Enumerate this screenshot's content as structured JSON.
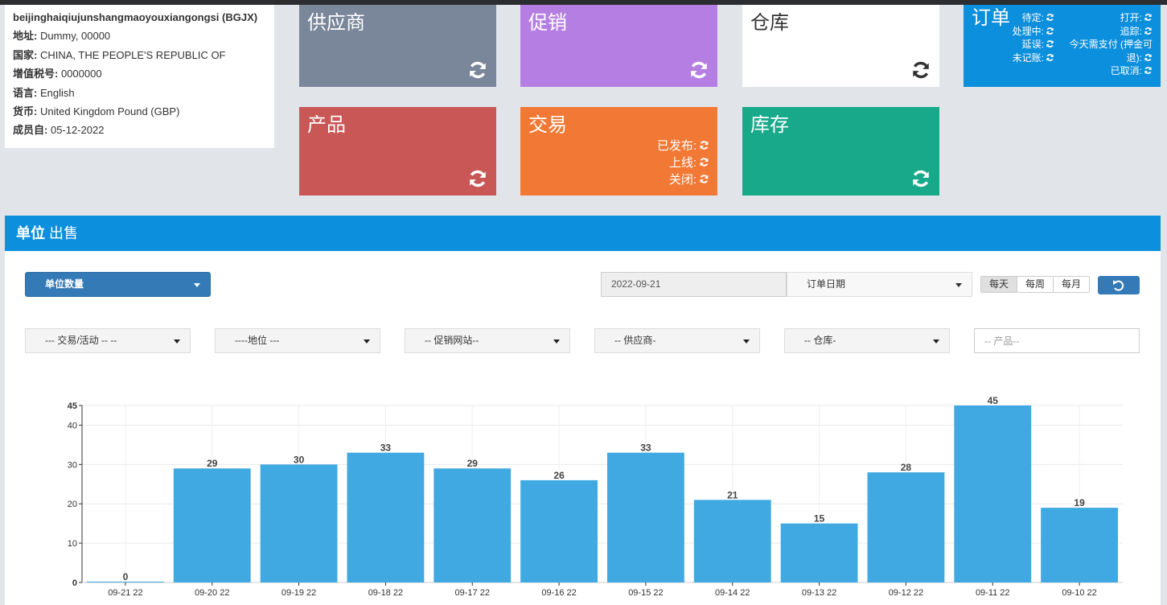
{
  "company": {
    "name": "beijinghaiqiujunshangmaoyouxiangongsi (BGJX)",
    "rows": [
      {
        "label": "地址:",
        "value": "Dummy, 00000"
      },
      {
        "label": "国家:",
        "value": "CHINA, THE PEOPLE'S REPUBLIC OF"
      },
      {
        "label": "增值税号:",
        "value": "0000000"
      },
      {
        "label": "语言:",
        "value": "English"
      },
      {
        "label": "货币:",
        "value": "United Kingdom Pound (GBP)"
      },
      {
        "label": "成员自:",
        "value": "05-12-2022"
      }
    ]
  },
  "tiles": {
    "supplier": "供应商",
    "promo": "促销",
    "warehouse": "仓库",
    "product": "产品",
    "trade": {
      "title": "交易",
      "stats": [
        "已发布:",
        "上线:",
        "关闭:"
      ]
    },
    "stock": "库存",
    "orders": {
      "title": "订单",
      "left": [
        "待定:",
        "处理中:",
        "延误:",
        "未记账:"
      ],
      "right": [
        "打开:",
        "追踪:",
        "今天需支付 (押金可",
        "退):",
        "已取消:"
      ]
    }
  },
  "colors": {
    "supplier": "#7a8699",
    "promo": "#b57ee2",
    "warehouse": "#ffffff",
    "product": "#c85756",
    "trade": "#f27935",
    "stock": "#18a98a",
    "orders": "#0c8fdc",
    "bar": "#41a9e1"
  },
  "panel": {
    "title_bold": "单位",
    "title_rest": "出售",
    "metric_select": "单位数量",
    "date_value": "2022-09-21",
    "date_type": "订单日期",
    "periods": [
      "每天",
      "每周",
      "每月"
    ],
    "filters": [
      "--- 交易/活动 -- --",
      "----地位 ---",
      "-- 促销网站--",
      "-- 供应商-",
      "-- 仓库-"
    ],
    "product_placeholder": "-- 产品--"
  },
  "chart_data": {
    "type": "bar",
    "categories": [
      "09-21 22",
      "09-20 22",
      "09-19 22",
      "09-18 22",
      "09-17 22",
      "09-16 22",
      "09-15 22",
      "09-14 22",
      "09-13 22",
      "09-12 22",
      "09-11 22",
      "09-10 22"
    ],
    "values": [
      0,
      29,
      30,
      33,
      29,
      26,
      33,
      21,
      15,
      28,
      45,
      19
    ],
    "yticks": [
      0,
      10,
      20,
      30,
      40,
      45
    ],
    "ylim": [
      0,
      45
    ],
    "grid": true,
    "data_labels": true
  }
}
